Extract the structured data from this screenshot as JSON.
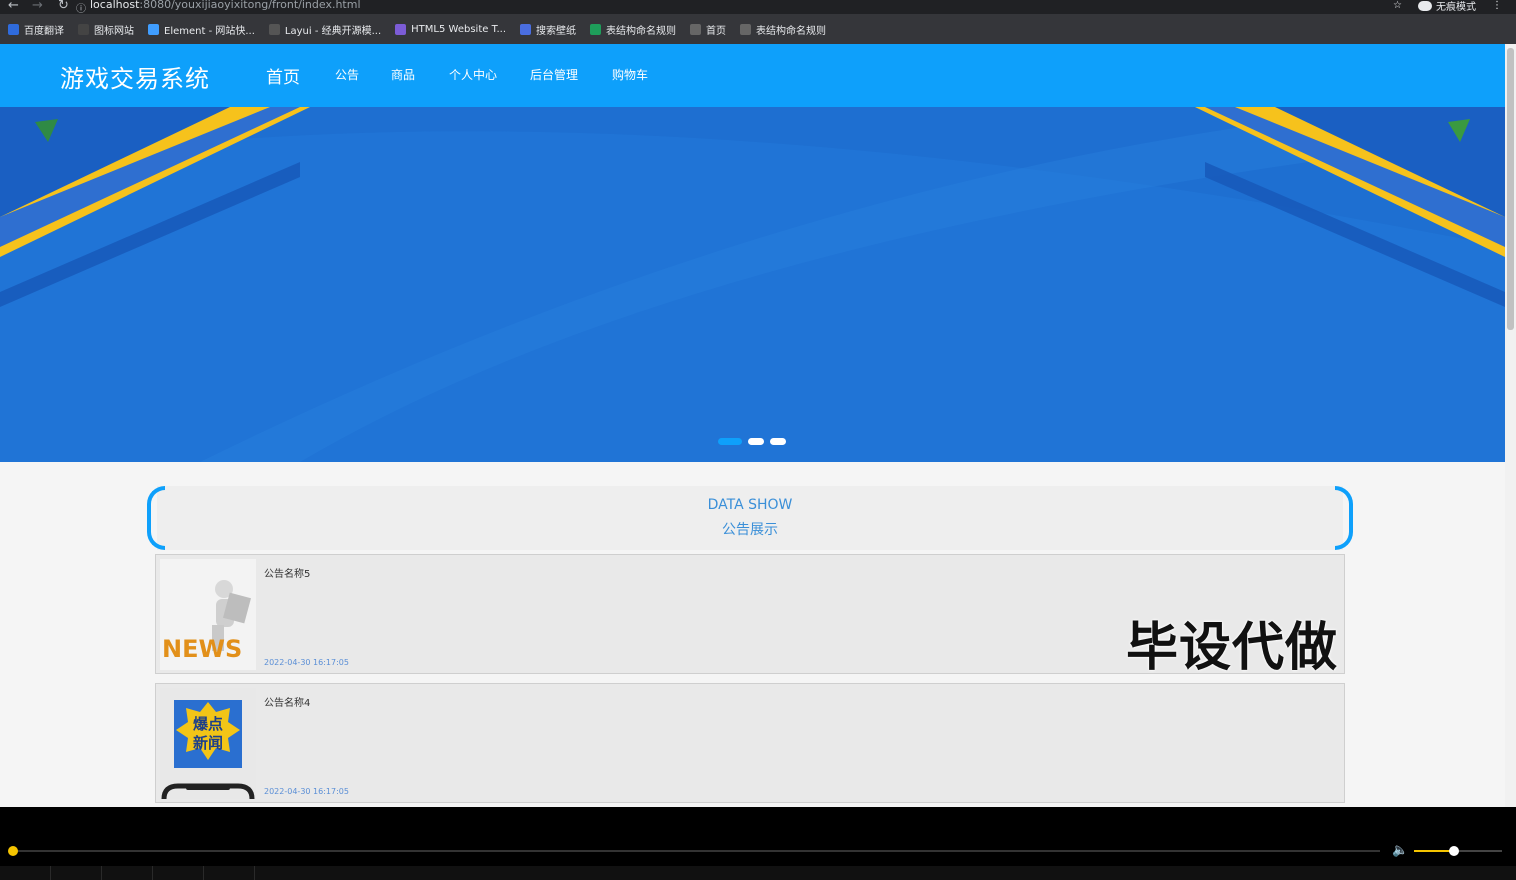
{
  "browser": {
    "url_host": "localhost",
    "url_path": ":8080/youxijiaoyixitong/front/index.html",
    "incognito_label": "无痕模式",
    "bookmarks": [
      {
        "label": "百度翻译",
        "icon": "translate-icon",
        "color": "#2f6bdc"
      },
      {
        "label": "图标网站",
        "icon": "flag-icon",
        "color": "#444444"
      },
      {
        "label": "Element - 网站快...",
        "icon": "element-icon",
        "color": "#409eff"
      },
      {
        "label": "Layui - 经典开源模...",
        "icon": "layui-icon",
        "color": "#555555"
      },
      {
        "label": "HTML5 Website T...",
        "icon": "html5-icon",
        "color": "#7c5cd6"
      },
      {
        "label": "搜索壁纸",
        "icon": "wallpaper-icon",
        "color": "#4a6ee0"
      },
      {
        "label": "表结构命名规则",
        "icon": "sheet-icon",
        "color": "#1e9e5a"
      },
      {
        "label": "首页",
        "icon": "globe-icon",
        "color": "#666666"
      },
      {
        "label": "表结构命名规则",
        "icon": "globe-icon",
        "color": "#666666"
      }
    ]
  },
  "site": {
    "title": "游戏交易系统",
    "nav": [
      "首页",
      "公告",
      "商品",
      "个人中心",
      "后台管理",
      "购物车"
    ],
    "section_en": "DATA SHOW",
    "section_cn": "公告展示",
    "watermark": "毕设代做",
    "notices": [
      {
        "title": "公告名称5",
        "time": "2022-04-30 16:17:05",
        "thumb_text": "NEWS"
      },
      {
        "title": "公告名称4",
        "time": "2022-04-30 16:17:05",
        "thumb_text": "爆点新闻"
      }
    ]
  },
  "carousel": {
    "slide_count": 3,
    "active_index": 0
  },
  "player": {
    "progress": 0.0,
    "volume": 0.45
  },
  "colors": {
    "brand": "#0ea0fb",
    "banner": "#1e6fd1",
    "accent": "#f5c400"
  }
}
